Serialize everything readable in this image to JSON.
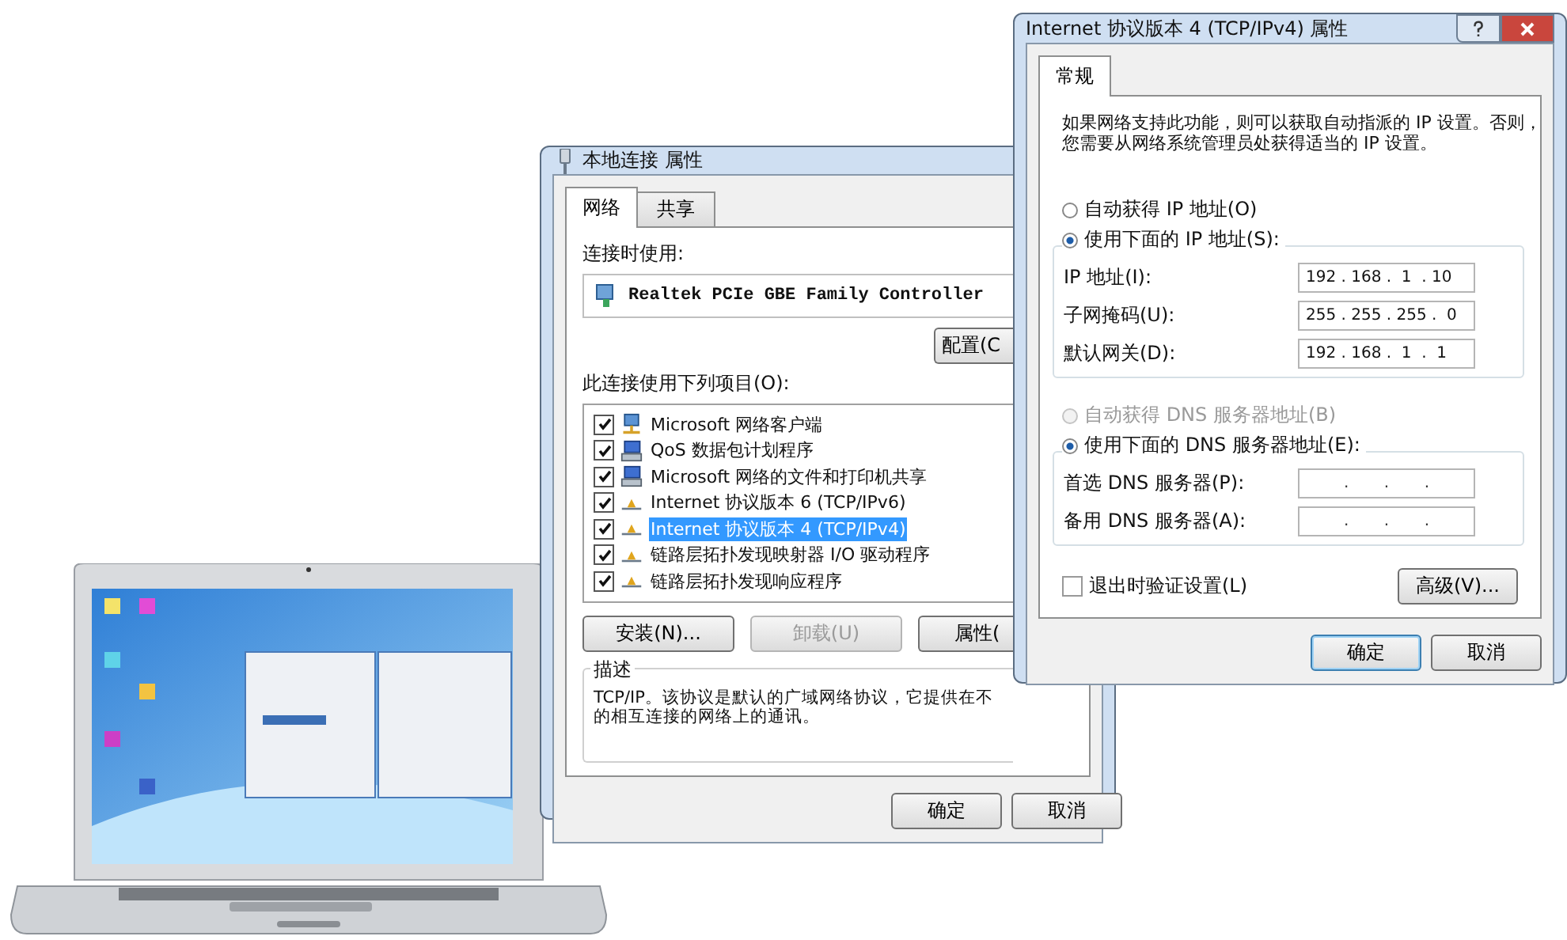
{
  "adapter_dialog": {
    "title": "本地连接 属性",
    "tabs": [
      {
        "label": "网络",
        "selected": true
      },
      {
        "label": "共享",
        "selected": false
      }
    ],
    "connect_using_label": "连接时使用:",
    "adapter": "Realtek PCIe GBE Family Controller",
    "configure_button": "配置(C",
    "items_label": "此连接使用下列项目(O):",
    "items": [
      {
        "label": "Microsoft 网络客户端",
        "checked": true,
        "selected": false,
        "kind": "client"
      },
      {
        "label": "QoS 数据包计划程序",
        "checked": true,
        "selected": false,
        "kind": "service"
      },
      {
        "label": "Microsoft 网络的文件和打印机共享",
        "checked": true,
        "selected": false,
        "kind": "service"
      },
      {
        "label": "Internet 协议版本 6 (TCP/IPv6)",
        "checked": true,
        "selected": false,
        "kind": "protocol"
      },
      {
        "label": "Internet 协议版本 4 (TCP/IPv4)",
        "checked": true,
        "selected": true,
        "kind": "protocol"
      },
      {
        "label": "链路层拓扑发现映射器 I/O 驱动程序",
        "checked": true,
        "selected": false,
        "kind": "protocol"
      },
      {
        "label": "链路层拓扑发现响应程序",
        "checked": true,
        "selected": false,
        "kind": "protocol"
      }
    ],
    "item_buttons": [
      {
        "label": "安装(N)...",
        "disabled": false
      },
      {
        "label": "卸载(U)",
        "disabled": true
      },
      {
        "label": "属性(",
        "disabled": false
      }
    ],
    "description_legend": "描述",
    "description_lines": [
      "TCP/IP。该协议是默认的广域网络协议，它提供在不",
      "的相互连接的网络上的通讯。"
    ],
    "ok_button": "确定",
    "cancel_button": "取消"
  },
  "ipv4_dialog": {
    "title": "Internet 协议版本 4 (TCP/IPv4) 属性",
    "tabs": [
      {
        "label": "常规",
        "selected": true
      }
    ],
    "intro": "如果网络支持此功能，则可以获取自动指派的 IP 设置。否则，您需要从网络系统管理员处获得适当的 IP 设置。",
    "ip_modes": [
      {
        "label": "自动获得 IP 地址(O)",
        "selected": false,
        "disabled": false
      },
      {
        "label": "使用下面的 IP 地址(S):",
        "selected": true,
        "disabled": false
      }
    ],
    "ip_fields": [
      {
        "label": "IP 地址(I):",
        "value": "192 . 168 .  1  . 10"
      },
      {
        "label": "子网掩码(U):",
        "value": "255 . 255 . 255 .  0"
      },
      {
        "label": "默认网关(D):",
        "value": "192 . 168 .  1  .  1"
      }
    ],
    "dns_modes": [
      {
        "label": "自动获得 DNS 服务器地址(B)",
        "selected": false,
        "disabled": true
      },
      {
        "label": "使用下面的 DNS 服务器地址(E):",
        "selected": true,
        "disabled": false
      }
    ],
    "dns_fields": [
      {
        "label": "首选 DNS 服务器(P):",
        "value": ".       .       ."
      },
      {
        "label": "备用 DNS 服务器(A):",
        "value": ".       .       ."
      }
    ],
    "validate": {
      "label": "退出时验证设置(L)",
      "checked": false
    },
    "advanced_button": "高级(V)...",
    "ok_button": "确定",
    "cancel_button": "取消"
  }
}
